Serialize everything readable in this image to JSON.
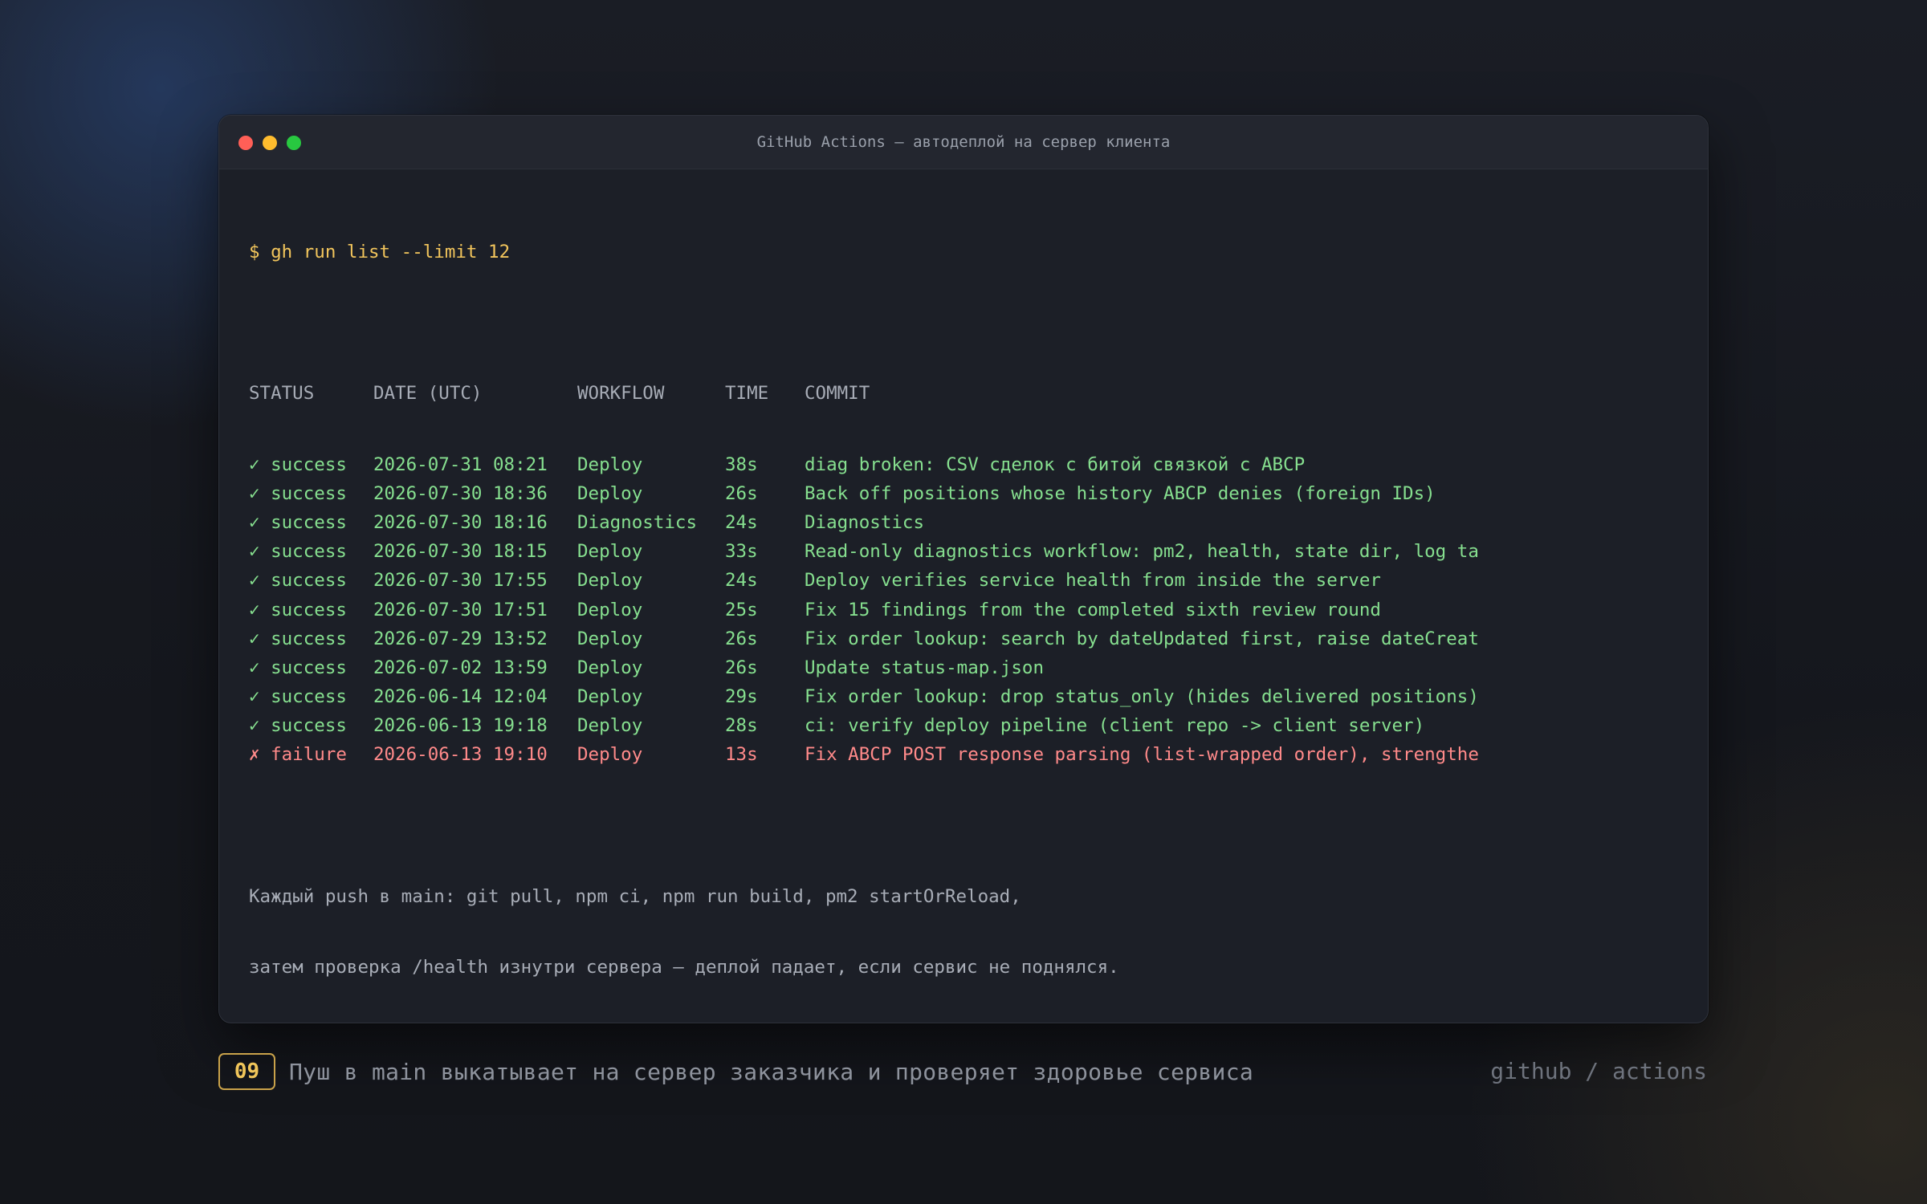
{
  "window": {
    "title": "GitHub Actions — автодеплой на сервер клиента"
  },
  "terminal": {
    "prompt": "$",
    "command": "gh run list --limit 12",
    "headers": {
      "status": "STATUS",
      "date": "DATE (UTC)",
      "workflow": "WORKFLOW",
      "time": "TIME",
      "commit": "COMMIT"
    },
    "runs": [
      {
        "icon": "✓",
        "status": "success",
        "date": "2026-07-31 08:21",
        "workflow": "Deploy",
        "time": "38s",
        "commit": "diag broken: CSV сделок с битой связкой с ABCP"
      },
      {
        "icon": "✓",
        "status": "success",
        "date": "2026-07-30 18:36",
        "workflow": "Deploy",
        "time": "26s",
        "commit": "Back off positions whose history ABCP denies (foreign IDs)"
      },
      {
        "icon": "✓",
        "status": "success",
        "date": "2026-07-30 18:16",
        "workflow": "Diagnostics",
        "time": "24s",
        "commit": "Diagnostics"
      },
      {
        "icon": "✓",
        "status": "success",
        "date": "2026-07-30 18:15",
        "workflow": "Deploy",
        "time": "33s",
        "commit": "Read-only diagnostics workflow: pm2, health, state dir, log ta"
      },
      {
        "icon": "✓",
        "status": "success",
        "date": "2026-07-30 17:55",
        "workflow": "Deploy",
        "time": "24s",
        "commit": "Deploy verifies service health from inside the server"
      },
      {
        "icon": "✓",
        "status": "success",
        "date": "2026-07-30 17:51",
        "workflow": "Deploy",
        "time": "25s",
        "commit": "Fix 15 findings from the completed sixth review round"
      },
      {
        "icon": "✓",
        "status": "success",
        "date": "2026-07-29 13:52",
        "workflow": "Deploy",
        "time": "26s",
        "commit": "Fix order lookup: search by dateUpdated first, raise dateCreat"
      },
      {
        "icon": "✓",
        "status": "success",
        "date": "2026-07-02 13:59",
        "workflow": "Deploy",
        "time": "26s",
        "commit": "Update status-map.json"
      },
      {
        "icon": "✓",
        "status": "success",
        "date": "2026-06-14 12:04",
        "workflow": "Deploy",
        "time": "29s",
        "commit": "Fix order lookup: drop status_only (hides delivered positions)"
      },
      {
        "icon": "✓",
        "status": "success",
        "date": "2026-06-13 19:18",
        "workflow": "Deploy",
        "time": "28s",
        "commit": "ci: verify deploy pipeline (client repo -> client server)"
      },
      {
        "icon": "✗",
        "status": "failure",
        "date": "2026-06-13 19:10",
        "workflow": "Deploy",
        "time": "13s",
        "commit": "Fix ABCP POST response parsing (list-wrapped order), strengthe"
      }
    ],
    "notes": [
      "Каждый push в main: git pull, npm ci, npm run build, pm2 startOrReload,",
      "затем проверка /health изнутри сервера — деплой падает, если сервис не поднялся."
    ]
  },
  "footer": {
    "slide_number": "09",
    "caption": "Пуш в main выкатывает на сервер заказчика и проверяет здоровье сервиса",
    "brand": "github / actions"
  },
  "colors": {
    "success": "#86df8f",
    "failure": "#ff8a8a",
    "command": "#f2c55c",
    "accent": "#c9a24a"
  }
}
